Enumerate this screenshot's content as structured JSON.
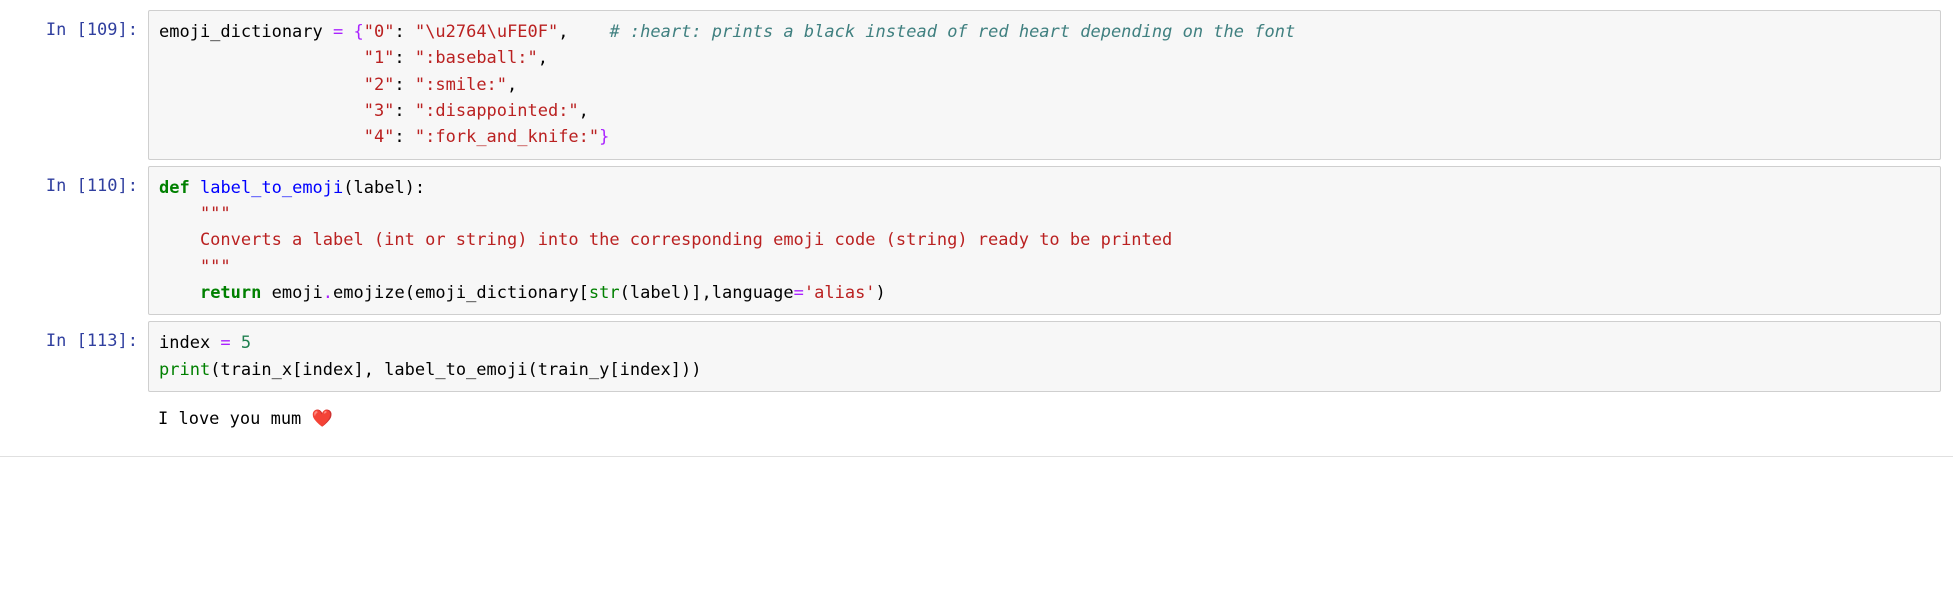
{
  "cells": [
    {
      "prompt": "In [109]:",
      "code": {
        "l1a": "emoji_dictionary ",
        "l1_eq": "=",
        "l1b": " {",
        "l1_k": "\"0\"",
        "l1c": ": ",
        "l1_v": "\"\\u2764\\uFE0F\"",
        "l1d": ",    ",
        "l1_cmt": "# :heart: prints a black instead of red heart depending on the font",
        "pad": "                    ",
        "l2_k": "\"1\"",
        "l2_v": "\":baseball:\"",
        "l3_k": "\"2\"",
        "l3_v": "\":smile:\"",
        "l4_k": "\"3\"",
        "l4_v": "\":disappointed:\"",
        "l5_k": "\"4\"",
        "l5_v": "\":fork_and_knife:\"",
        "l5_end": "}"
      }
    },
    {
      "prompt": "In [110]:",
      "code": {
        "kw_def": "def",
        "sp": " ",
        "fname": "label_to_emoji",
        "sig": "(label):",
        "doc1": "    \"\"\"",
        "doc2": "    Converts a label (int or string) into the corresponding emoji code (string) ready to be printed",
        "doc3": "    \"\"\"",
        "ret_pad": "    ",
        "kw_ret": "return",
        "ret_a": " emoji",
        "ret_dot": ".",
        "ret_b": "emojize(emoji_dictionary[",
        "bi_str": "str",
        "ret_c": "(label)],language",
        "ret_eq": "=",
        "ret_s": "'alias'",
        "ret_d": ")"
      }
    },
    {
      "prompt": "In [113]:",
      "code": {
        "l1a": "index ",
        "l1eq": "=",
        "l1b": " ",
        "l1n": "5",
        "l2_print": "print",
        "l2a": "(train_x[index], label_to_emoji(train_y[index]))"
      },
      "output": {
        "text": "I love you mum ",
        "heart": "❤️"
      }
    }
  ]
}
